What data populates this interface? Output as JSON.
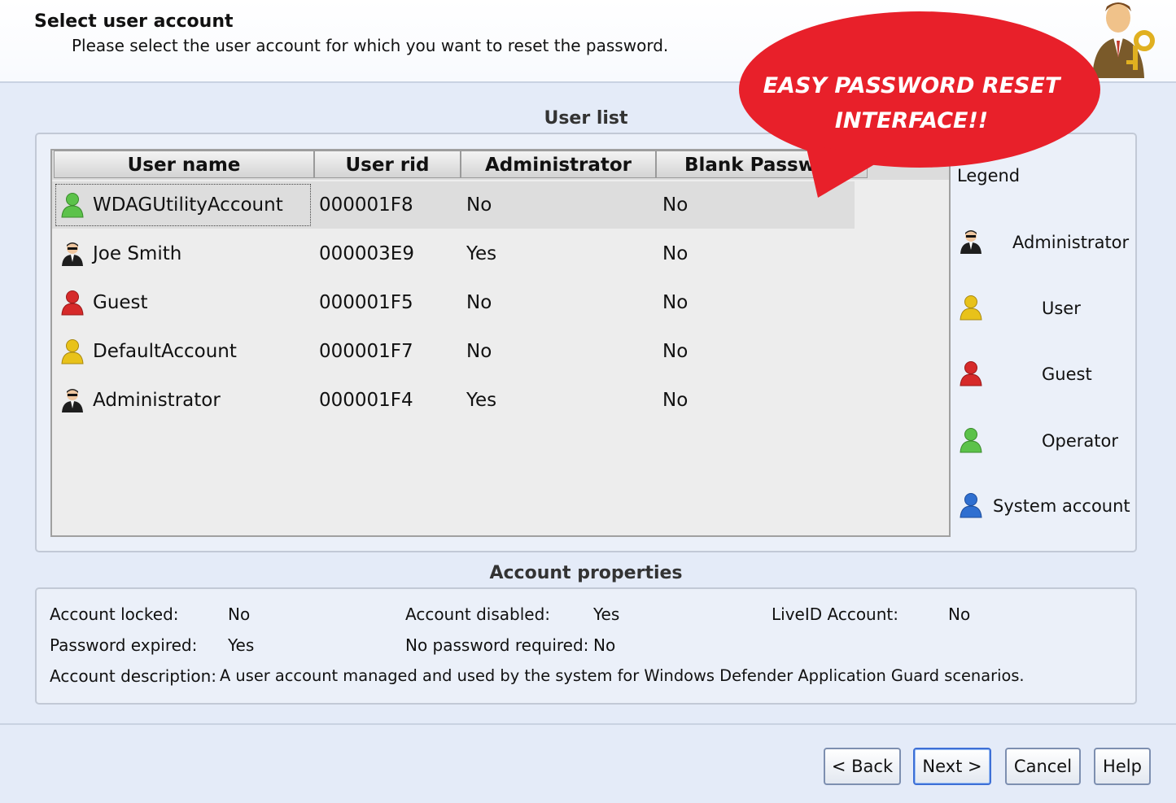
{
  "header": {
    "title": "Select user account",
    "subtitle": "Please select the user account for which you want to reset the password.",
    "icon": "user-key-icon"
  },
  "callout": {
    "line1": "EASY PASSWORD RESET",
    "line2": "INTERFACE!!",
    "color": "#e8202a"
  },
  "user_list": {
    "title": "User list",
    "columns": [
      "User name",
      "User rid",
      "Administrator",
      "Blank Passwor"
    ],
    "rows": [
      {
        "name": "WDAGUtilityAccount",
        "rid": "000001F8",
        "admin": "No",
        "blank": "No",
        "type": "operator"
      },
      {
        "name": "Joe Smith",
        "rid": "000003E9",
        "admin": "Yes",
        "blank": "No",
        "type": "administrator"
      },
      {
        "name": "Guest",
        "rid": "000001F5",
        "admin": "No",
        "blank": "No",
        "type": "guest"
      },
      {
        "name": "DefaultAccount",
        "rid": "000001F7",
        "admin": "No",
        "blank": "No",
        "type": "user"
      },
      {
        "name": "Administrator",
        "rid": "000001F4",
        "admin": "Yes",
        "blank": "No",
        "type": "administrator"
      }
    ],
    "selected_row": "WDAGUtilityAccount"
  },
  "legend": {
    "title": "Legend",
    "items": [
      {
        "label": "Administrator",
        "icon": "administrator-user-icon"
      },
      {
        "label": "User",
        "icon": "yellow-user-icon"
      },
      {
        "label": "Guest",
        "icon": "red-user-icon"
      },
      {
        "label": "Operator",
        "icon": "green-user-icon"
      },
      {
        "label": "System account",
        "icon": "blue-user-icon"
      }
    ]
  },
  "properties": {
    "title": "Account properties",
    "account_locked_label": "Account locked:",
    "account_locked_value": "No",
    "account_disabled_label": "Account disabled:",
    "account_disabled_value": "Yes",
    "liveid_label": "LiveID Account:",
    "liveid_value": "No",
    "password_expired_label": "Password expired:",
    "password_expired_value": "Yes",
    "no_password_label": "No password required:",
    "no_password_value": "No",
    "description_label": "Account description:",
    "description_value": "A user account managed and used by the system for Windows Defender Application Guard scenarios."
  },
  "buttons": {
    "back": "< Back",
    "next": "Next >",
    "cancel": "Cancel",
    "help": "Help"
  },
  "colors": {
    "administrator": "#1a1a1a",
    "user": "#e8c21a",
    "guest": "#d62a2a",
    "operator": "#5cc24a",
    "system": "#2f6fd0"
  }
}
